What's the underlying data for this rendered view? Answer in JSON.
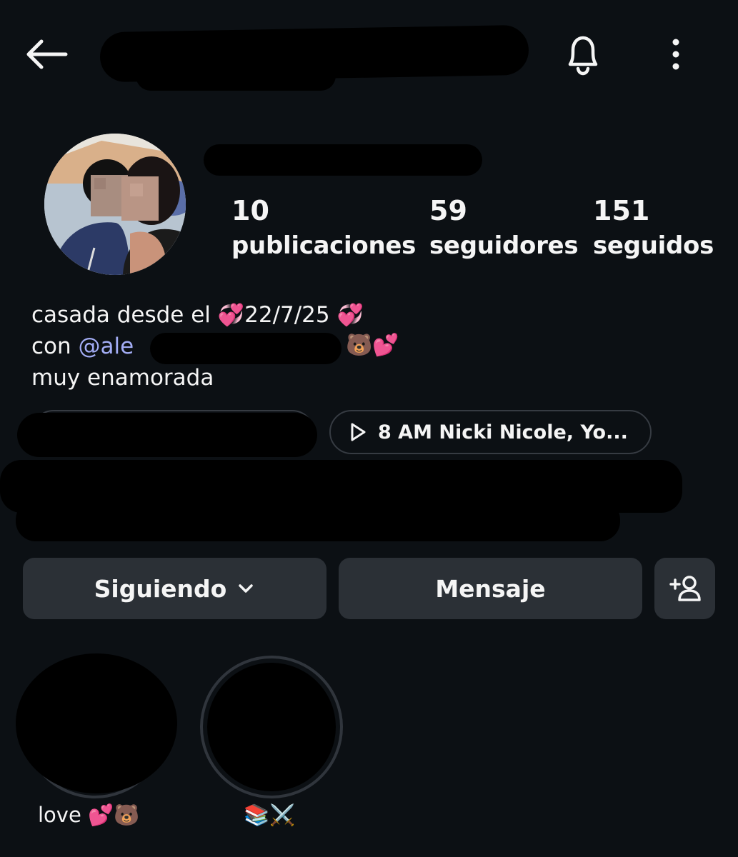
{
  "header": {
    "back_icon": "arrow-left-icon",
    "notifications_icon": "bell-icon",
    "more_icon": "more-vertical-icon"
  },
  "profile": {
    "stats": [
      {
        "value": "10",
        "label": "publicaciones"
      },
      {
        "value": "59",
        "label": "seguidores"
      },
      {
        "value": "151",
        "label": "seguidos"
      }
    ],
    "bio": {
      "line1_text": "casada desde el ",
      "line1_date": "22/7/25",
      "line1_emoji": "💞",
      "line2_prefix": "con ",
      "line2_mention": "@ale",
      "line2_emojis": "🐻💕",
      "line3": "muy enamorada"
    },
    "music": {
      "icon": "play-icon",
      "text": "8 AM Nicki Nicole, Yo..."
    }
  },
  "actions": {
    "following_label": "Siguiendo",
    "following_icon": "chevron-down-icon",
    "message_label": "Mensaje",
    "suggest_icon": "add-person-icon"
  },
  "highlights": [
    {
      "label": "love 💕🐻"
    },
    {
      "label": "📚⚔️"
    }
  ],
  "colors": {
    "background": "#0c1014",
    "button": "#2b3036",
    "mention": "#a3adf5"
  }
}
